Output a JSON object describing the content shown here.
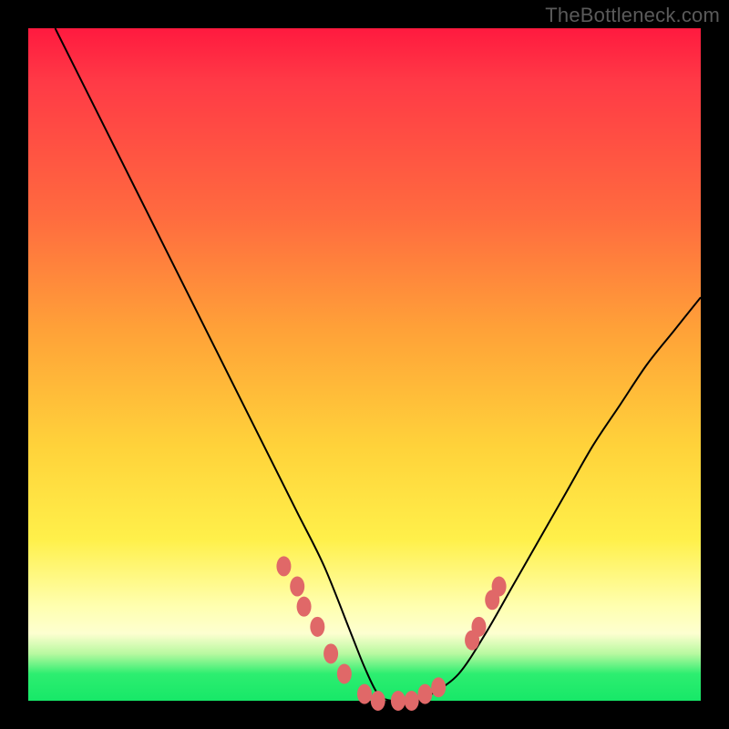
{
  "watermark": "TheBottleneck.com",
  "colors": {
    "frame": "#000000",
    "gradient_top": "#ff1a3f",
    "gradient_bottom": "#17e868",
    "curve": "#000000",
    "dots": "#e06868"
  },
  "chart_data": {
    "type": "line",
    "title": "",
    "xlabel": "",
    "ylabel": "",
    "xlim": [
      0,
      100
    ],
    "ylim": [
      0,
      100
    ],
    "series": [
      {
        "name": "bottleneck-curve",
        "x": [
          4,
          8,
          12,
          16,
          20,
          24,
          28,
          32,
          36,
          40,
          44,
          48,
          50,
          52,
          54,
          56,
          58,
          60,
          64,
          68,
          72,
          76,
          80,
          84,
          88,
          92,
          96,
          100
        ],
        "y": [
          100,
          92,
          84,
          76,
          68,
          60,
          52,
          44,
          36,
          28,
          20,
          10,
          5,
          1,
          0,
          0,
          0,
          1,
          4,
          10,
          17,
          24,
          31,
          38,
          44,
          50,
          55,
          60
        ]
      }
    ],
    "markers": {
      "name": "highlight-dots",
      "color": "#e06868",
      "points": [
        {
          "x": 38,
          "y": 20
        },
        {
          "x": 40,
          "y": 17
        },
        {
          "x": 41,
          "y": 14
        },
        {
          "x": 43,
          "y": 11
        },
        {
          "x": 45,
          "y": 7
        },
        {
          "x": 47,
          "y": 4
        },
        {
          "x": 50,
          "y": 1
        },
        {
          "x": 52,
          "y": 0
        },
        {
          "x": 55,
          "y": 0
        },
        {
          "x": 57,
          "y": 0
        },
        {
          "x": 59,
          "y": 1
        },
        {
          "x": 61,
          "y": 2
        },
        {
          "x": 66,
          "y": 9
        },
        {
          "x": 67,
          "y": 11
        },
        {
          "x": 69,
          "y": 15
        },
        {
          "x": 70,
          "y": 17
        }
      ]
    }
  }
}
